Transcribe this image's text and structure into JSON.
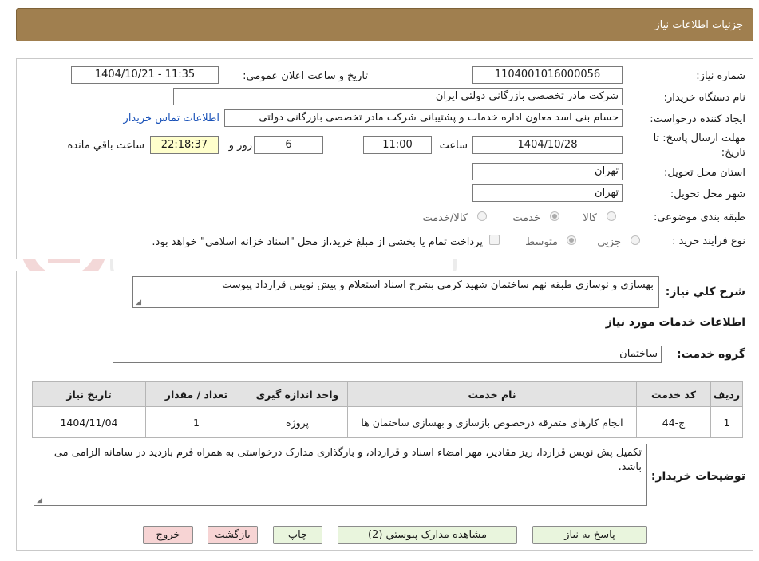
{
  "header": {
    "title": "جزئیات اطلاعات نیاز"
  },
  "form": {
    "need_number_label": "شماره نیاز:",
    "need_number": "1104001016000056",
    "announce_label": "تاریخ و ساعت اعلان عمومی:",
    "announce_value": "1404/10/21 - 11:35",
    "buyer_org_label": "نام دستگاه خریدار:",
    "buyer_org": "شرکت مادر تخصصی بازرگانی دولتی ایران",
    "creator_label": "ایجاد کننده درخواست:",
    "creator": "حسام بنی اسد معاون اداره خدمات و پشتیبانی شرکت مادر تخصصی بازرگانی دولتی",
    "contact_link": "اطلاعات تماس خریدار",
    "deadline_label_1": "مهلت ارسال پاسخ: تا",
    "deadline_label_2": "تاریخ:",
    "deadline_date": "1404/10/28",
    "time_label": "ساعت",
    "deadline_time": "11:00",
    "days_value": "6",
    "days_label": "روز و",
    "remaining_time": "22:18:37",
    "remaining_label": "ساعت باقي مانده",
    "province_label": "استان محل تحویل:",
    "province": "تهران",
    "city_label": "شهر محل تحویل:",
    "city": "تهران",
    "category_label": "طبقه بندی موضوعی:",
    "category_options": [
      "کالا",
      "خدمت",
      "کالا/خدمت"
    ],
    "category_selected": "خدمت",
    "process_label": "نوع فرآیند خرید :",
    "process_options": [
      "جزیي",
      "متوسط"
    ],
    "process_selected": "متوسط",
    "payment_note": "پرداخت تمام یا بخشی از مبلغ خرید،از محل \"اسناد خزانه اسلامی\" خواهد بود.",
    "description_label": "شرح کلي نیاز:",
    "description": "بهسازی و نوسازی طبقه نهم ساختمان شهید کرمی بشرح اسناد استعلام و پیش نویس قرارداد پیوست",
    "services_heading": "اطلاعات خدمات مورد نیاز",
    "service_group_label": "گروه خدمت:",
    "service_group": "ساختمان",
    "buyer_notes_label": "توضیحات خریدار:",
    "buyer_notes": "تکمیل پش نویس قراردا، ریز مقادیر، مهر امضاء اسناد و قرارداد، و بارگذاری مدارک درخواستی به همراه فرم بازدید در سامانه الزامی می باشد."
  },
  "table": {
    "headers": [
      "ردیف",
      "کد خدمت",
      "نام خدمت",
      "واحد اندازه گیری",
      "تعداد / مقدار",
      "تاریخ نیاز"
    ],
    "rows": [
      [
        "1",
        "ج-44",
        "انجام کارهای متفرقه درخصوص بازسازی و بهسازی ساختمان ها",
        "پروژه",
        "1",
        "1404/11/04"
      ]
    ]
  },
  "buttons": {
    "reply": "پاسخ به نیاز",
    "view_docs": "مشاهده مدارک پیوستي (2)",
    "print": "چاپ",
    "back": "بازگشت",
    "exit": "خروج"
  },
  "colors": {
    "header_bg": "#a07f4f",
    "link": "#1a52b8",
    "green_button": "#e9f5dd",
    "pink_button": "#f7d4d4",
    "remaining_bg": "#ffffcc"
  }
}
